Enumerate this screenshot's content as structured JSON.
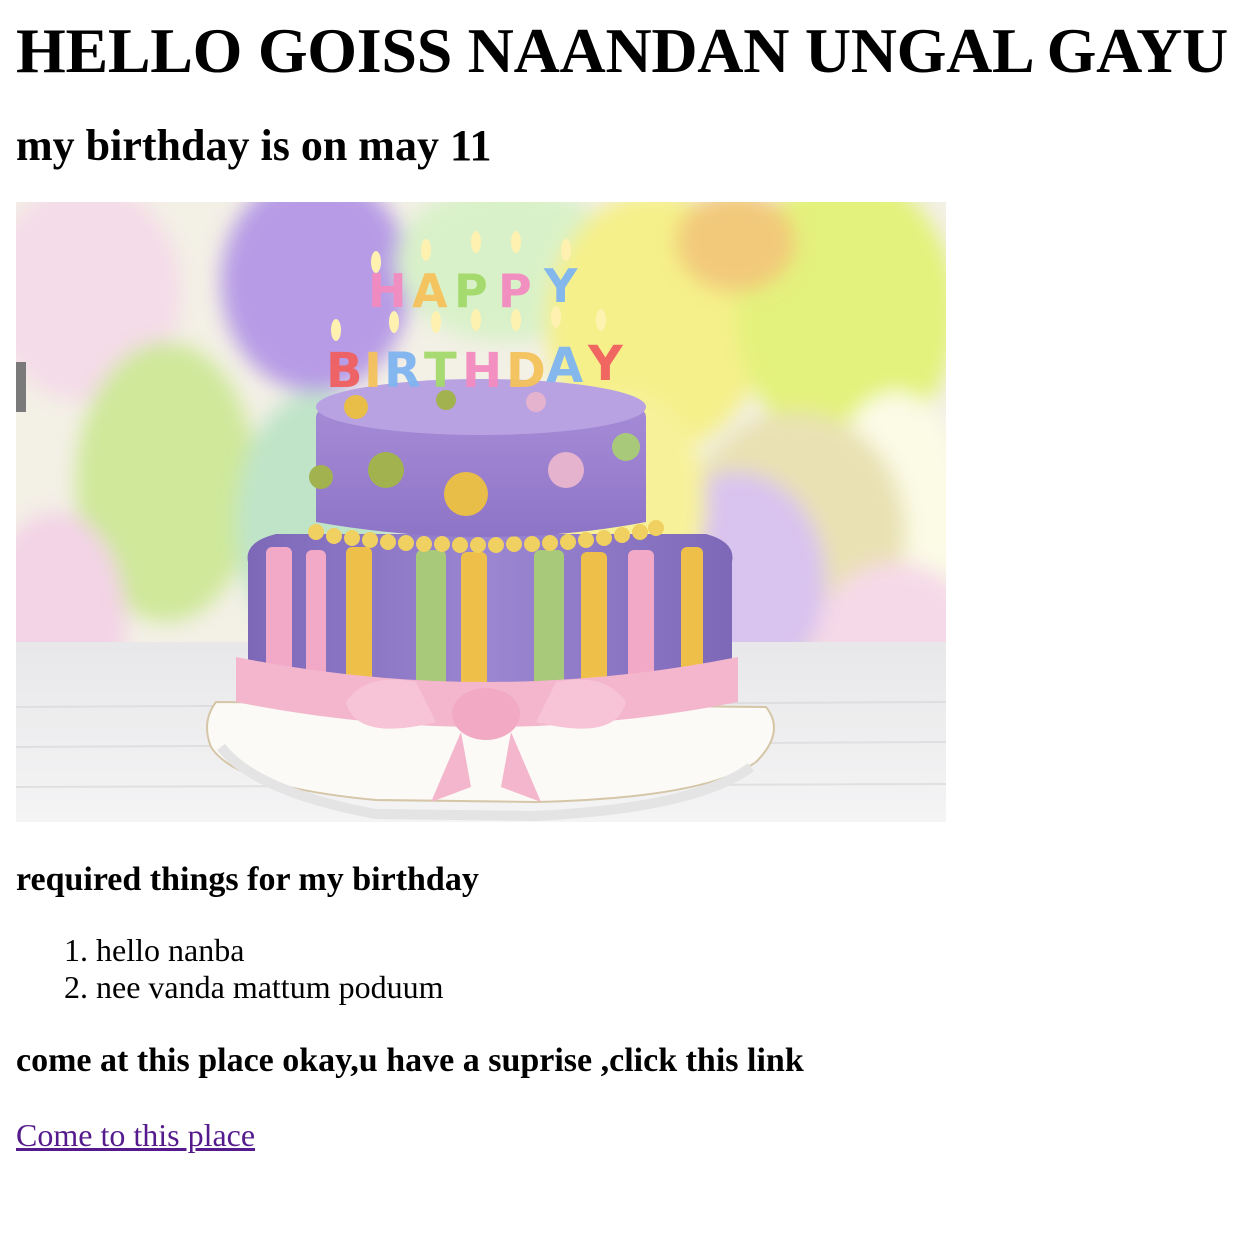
{
  "page": {
    "title": "HELLO GOISS NAANDAN UNGAL GAYU",
    "subtitle": "my birthday is on may 11",
    "image": {
      "name": "birthday-cake-image",
      "candle_letters_top": "HAPPY",
      "candle_letters_bottom": "BIRTHDAY"
    },
    "required_heading": "required things for my birthday",
    "required_items": [
      "hello nanba",
      "nee vanda mattum poduum"
    ],
    "place_heading": "come at this place okay,u have a suprise ,click this link",
    "place_link": "Come to this place"
  },
  "colors": {
    "link_visited": "#551a8b",
    "text": "#000000",
    "background": "#ffffff"
  }
}
